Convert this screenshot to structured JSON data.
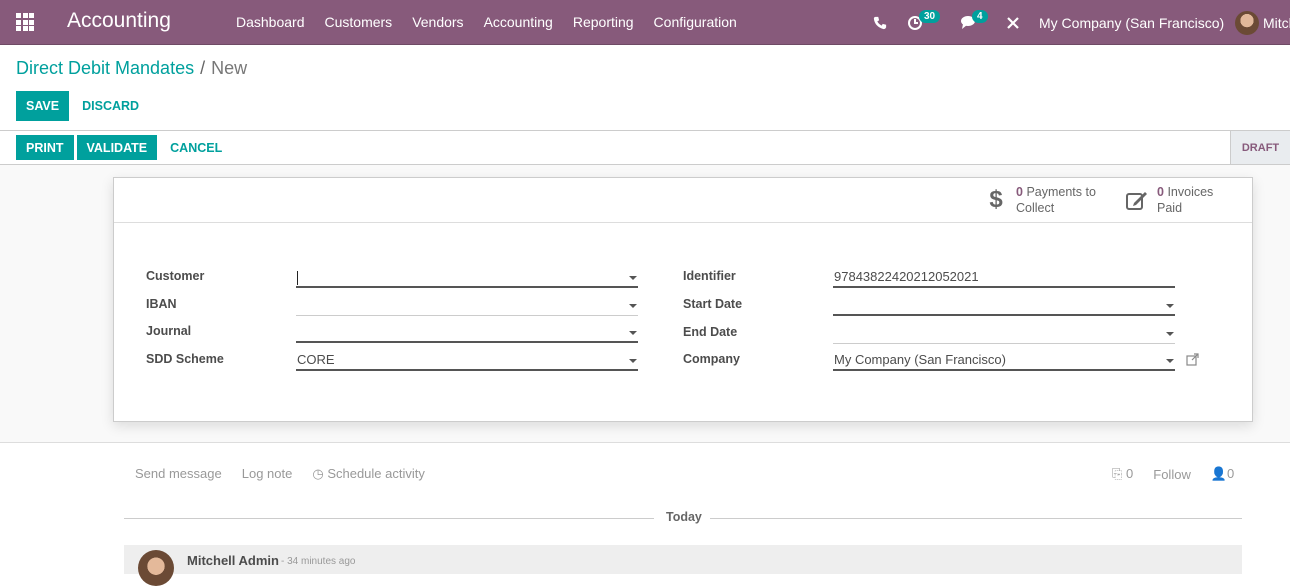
{
  "navbar": {
    "app_name": "Accounting",
    "menu": [
      "Dashboard",
      "Customers",
      "Vendors",
      "Accounting",
      "Reporting",
      "Configuration"
    ],
    "activity_count": "30",
    "messages_count": "4",
    "company": "My Company (San Francisco)",
    "user": "Mitch"
  },
  "breadcrumb": {
    "parent": "Direct Debit Mandates",
    "separator": "/",
    "current": "New"
  },
  "toolbar": {
    "save": "SAVE",
    "discard": "DISCARD"
  },
  "statusbar": {
    "print": "PRINT",
    "validate": "VALIDATE",
    "cancel": "CANCEL",
    "state": "DRAFT"
  },
  "stats": {
    "payments": {
      "count": "0",
      "label1": "Payments to",
      "label2": "Collect"
    },
    "invoices": {
      "count": "0",
      "label1": "Invoices",
      "label2": "Paid"
    }
  },
  "form": {
    "left": [
      {
        "label": "Customer",
        "value": ""
      },
      {
        "label": "IBAN",
        "value": ""
      },
      {
        "label": "Journal",
        "value": ""
      },
      {
        "label": "SDD Scheme",
        "value": "CORE"
      }
    ],
    "right": [
      {
        "label": "Identifier",
        "value": "9784382242021205202 1"
      },
      {
        "label": "Start Date",
        "value": ""
      },
      {
        "label": "End Date",
        "value": ""
      },
      {
        "label": "Company",
        "value": "My Company (San Francisco)"
      }
    ]
  },
  "chatter": {
    "send_message": "Send message",
    "log_note": "Log note",
    "schedule_activity": "Schedule activity",
    "attachments": "0",
    "follow": "Follow",
    "followers": "0",
    "today": "Today",
    "message": {
      "author": "Mitchell Admin",
      "date": "- 34 minutes ago"
    }
  }
}
